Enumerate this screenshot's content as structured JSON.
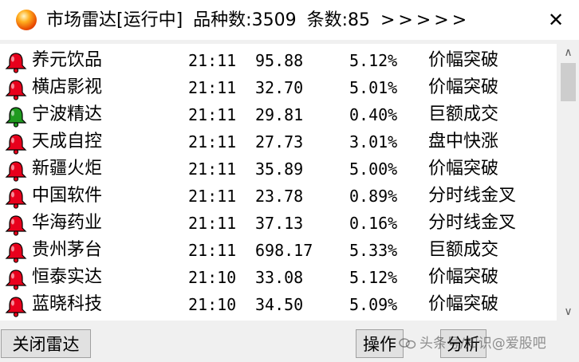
{
  "window": {
    "title": "市场雷达[运行中]",
    "count_label": "品种数:3509",
    "records_label": "条数:85",
    "arrows": ">>>>>",
    "close_symbol": "✕"
  },
  "colors": {
    "bell_red": "#e8001c",
    "bell_green": "#1f9a1f"
  },
  "rows": [
    {
      "icon": "red-bell-icon",
      "name": "养元饮品",
      "time": "21:11",
      "price": "95.88",
      "pct": "5.12%",
      "signal": "价幅突破"
    },
    {
      "icon": "red-bell-icon",
      "name": "横店影视",
      "time": "21:11",
      "price": "32.70",
      "pct": "5.01%",
      "signal": "价幅突破"
    },
    {
      "icon": "green-bell-icon",
      "name": "宁波精达",
      "time": "21:11",
      "price": "29.81",
      "pct": "0.40%",
      "signal": "巨额成交"
    },
    {
      "icon": "red-bell-icon",
      "name": "天成自控",
      "time": "21:11",
      "price": "27.73",
      "pct": "3.01%",
      "signal": "盘中快涨"
    },
    {
      "icon": "red-bell-icon",
      "name": "新疆火炬",
      "time": "21:11",
      "price": "35.89",
      "pct": "5.00%",
      "signal": "价幅突破"
    },
    {
      "icon": "red-bell-icon",
      "name": "中国软件",
      "time": "21:11",
      "price": "23.78",
      "pct": "0.89%",
      "signal": "分时线金叉"
    },
    {
      "icon": "red-bell-icon",
      "name": "华海药业",
      "time": "21:11",
      "price": "37.13",
      "pct": "0.16%",
      "signal": "分时线金叉"
    },
    {
      "icon": "red-bell-icon",
      "name": "贵州茅台",
      "time": "21:11",
      "price": "698.17",
      "pct": "5.33%",
      "signal": "巨额成交"
    },
    {
      "icon": "red-bell-icon",
      "name": "恒泰实达",
      "time": "21:10",
      "price": "33.08",
      "pct": "5.12%",
      "signal": "价幅突破"
    },
    {
      "icon": "red-bell-icon",
      "name": "蓝晓科技",
      "time": "21:10",
      "price": "34.50",
      "pct": "5.09%",
      "signal": "价幅突破"
    }
  ],
  "scrollbar": {
    "up_arrow": "∧",
    "down_arrow": "∨"
  },
  "buttons": {
    "close_radar": "关闭雷达",
    "operate": "操作",
    "analyze": "分析"
  },
  "watermark": {
    "text": "头条号/知识@爱股吧"
  }
}
